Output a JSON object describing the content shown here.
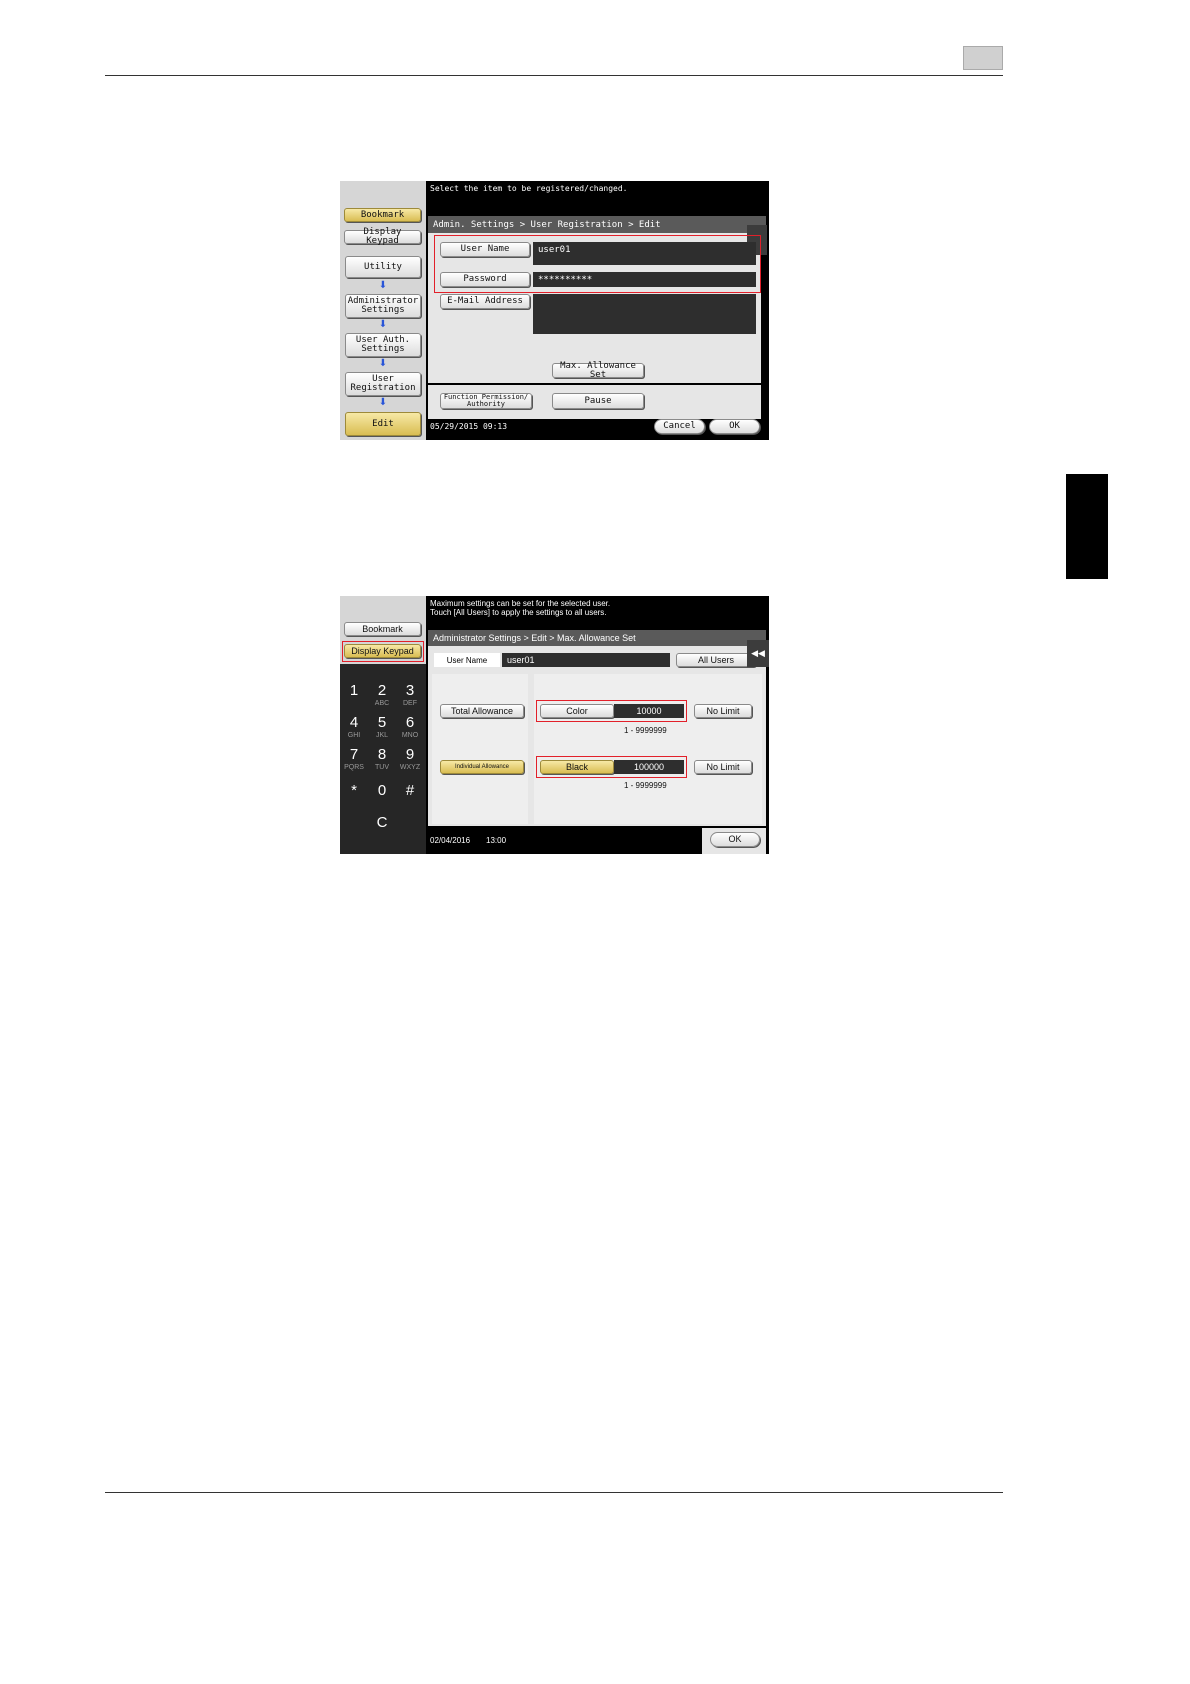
{
  "document": {
    "header_rule": true,
    "footer_rule": true
  },
  "screen1": {
    "message": "Select the item to be registered/changed.",
    "breadcrumb": "Admin. Settings > User Registration > Edit",
    "sidebar": {
      "bookmark": "Bookmark",
      "display_keypad": "Display Keypad",
      "steps": [
        "Utility",
        "Administrator Settings",
        "User Auth. Settings",
        "User Registration",
        "Edit"
      ]
    },
    "fields": {
      "user_name_label": "User Name",
      "user_name_value": "user01",
      "password_label": "Password",
      "password_value": "**********",
      "email_label": "E-Mail Address",
      "email_value": ""
    },
    "buttons": {
      "max_allowance": "Max. Allowance Set",
      "function_permission": "Function Permission/ Authority",
      "pause": "Pause",
      "cancel": "Cancel",
      "ok": "OK"
    },
    "datetime": "05/29/2015  09:13"
  },
  "screen2": {
    "message_line1": "Maximum settings can be set for the selected user.",
    "message_line2": "Touch [All Users] to apply the settings to all users.",
    "breadcrumb": "Administrator Settings > Edit > Max. Allowance Set",
    "sidebar": {
      "bookmark": "Bookmark",
      "display_keypad": "Display Keypad"
    },
    "keypad": {
      "keys": [
        {
          "n": "1",
          "s": ""
        },
        {
          "n": "2",
          "s": "ABC"
        },
        {
          "n": "3",
          "s": "DEF"
        },
        {
          "n": "4",
          "s": "GHI"
        },
        {
          "n": "5",
          "s": "JKL"
        },
        {
          "n": "6",
          "s": "MNO"
        },
        {
          "n": "7",
          "s": "PQRS"
        },
        {
          "n": "8",
          "s": "TUV"
        },
        {
          "n": "9",
          "s": "WXYZ"
        },
        {
          "n": "*",
          "s": ""
        },
        {
          "n": "0",
          "s": ""
        },
        {
          "n": "#",
          "s": ""
        }
      ],
      "clear": "C"
    },
    "user_name_label": "User Name",
    "user_name_value": "user01",
    "all_users": "All Users",
    "back_icon": "◀◀",
    "total_allowance": "Total Allowance",
    "individual_allowance": "Individual Allowance",
    "color_label": "Color",
    "color_value": "10000",
    "color_range": "1  -  9999999",
    "black_label": "Black",
    "black_value": "100000",
    "black_range": "1  -  9999999",
    "no_limit": "No Limit",
    "ok": "OK",
    "date": "02/04/2016",
    "time": "13:00"
  }
}
